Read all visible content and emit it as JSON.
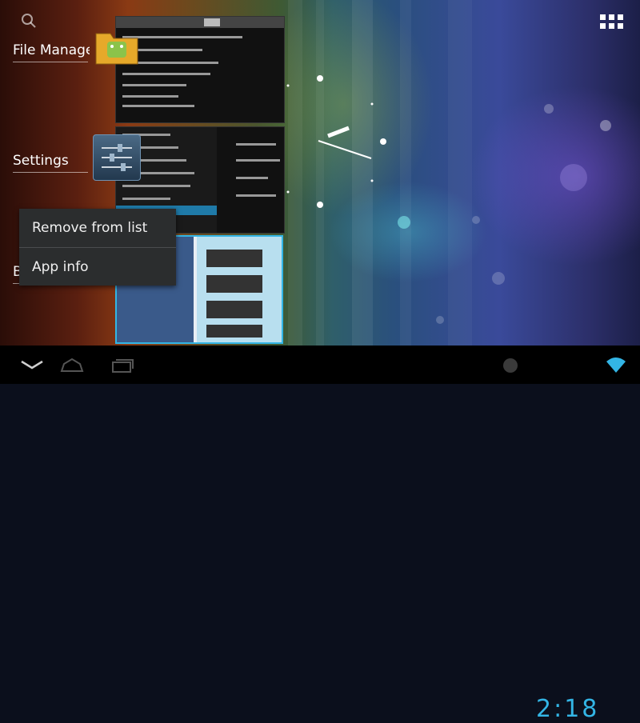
{
  "recent_apps": {
    "items": [
      {
        "label": "File Manage",
        "icon": "folder-android-icon"
      },
      {
        "label": "Settings",
        "icon": "settings-sliders-icon"
      },
      {
        "label": "B",
        "icon": "browser-icon"
      }
    ]
  },
  "context_menu": {
    "items": [
      {
        "label": "Remove from list"
      },
      {
        "label": "App info"
      }
    ]
  },
  "status_bar": {
    "time": "2:18",
    "icons": [
      "notification-icon",
      "wifi-icon"
    ]
  },
  "nav_bar": {
    "buttons": [
      "back-icon",
      "home-icon",
      "recent-apps-icon"
    ]
  },
  "top_icons": [
    "search-icon",
    "all-apps-icon"
  ],
  "colors": {
    "accent": "#33b5e5",
    "menu_bg": "#2b2d2e",
    "navbar_bg": "#000000"
  }
}
